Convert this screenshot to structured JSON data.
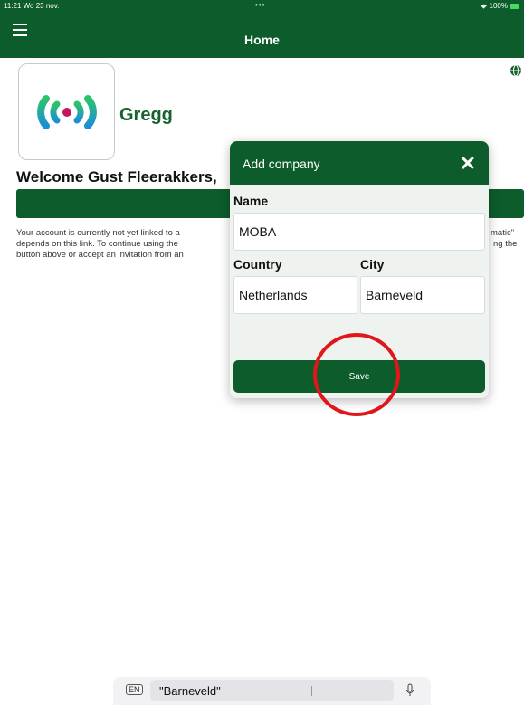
{
  "status_bar": {
    "time_date": "11:21  Wo 23 nov.",
    "dots": "•••",
    "battery": "100%"
  },
  "header": {
    "title": "Home"
  },
  "company": {
    "name": "Gregg"
  },
  "welcome": {
    "text": "Welcome Gust Fleerakkers,"
  },
  "notice": {
    "line1_start": "Your account is currently not yet linked to a",
    "line1_end": "matic\"",
    "line2_start": "depends on this link. To continue using the",
    "line2_end": "ng the",
    "line3_start": "button above or accept an invitation from an"
  },
  "dialog": {
    "title": "Add company",
    "close_symbol": "✕",
    "name_label": "Name",
    "name_value": "MOBA",
    "country_label": "Country",
    "country_value": "Netherlands",
    "city_label": "City",
    "city_value": "Barneveld",
    "save_label": "Save"
  },
  "keyboard": {
    "language": "EN",
    "suggestion": "\"Barneveld\""
  },
  "colors": {
    "primary": "#0d5c2b",
    "annotation": "#e0161b"
  }
}
